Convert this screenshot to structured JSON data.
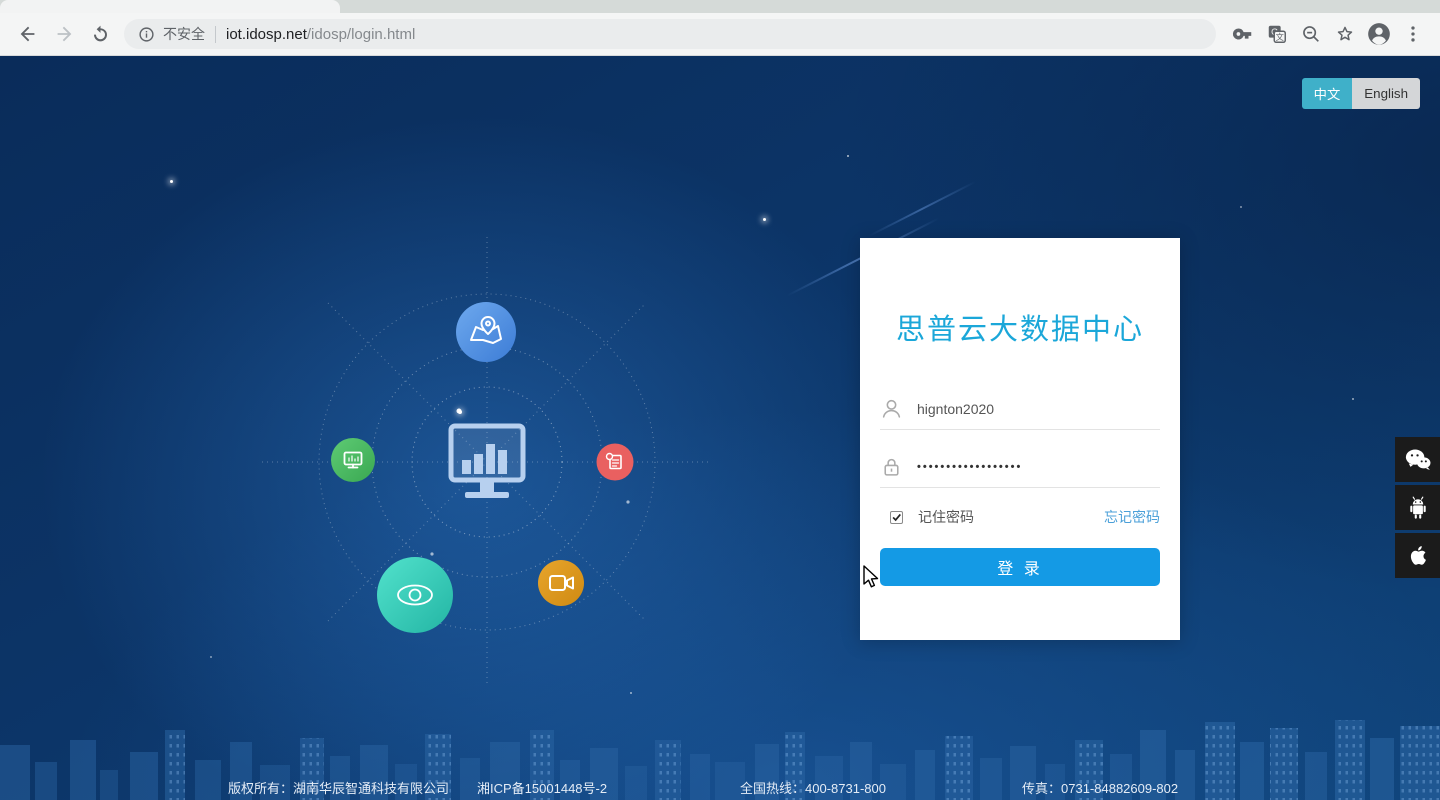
{
  "browser": {
    "security_label": "不安全",
    "url_host": "iot.idosp.net",
    "url_path": "/idosp/login.html"
  },
  "language": {
    "zh": "中文",
    "en": "English"
  },
  "login": {
    "title": "思普云大数据中心",
    "username": "hignton2020",
    "password_masked": "••••••••••••••••••",
    "remember": "记住密码",
    "forgot": "忘记密码",
    "submit": "登 录"
  },
  "footer": {
    "copyright": "版权所有：湖南华辰智通科技有限公司",
    "icp": "湘ICP备15001448号-2",
    "hotline": "全国热线：400-8731-800",
    "fax": "传真：0731-84882609-802"
  },
  "colors": {
    "accent_title": "#1ba7d9",
    "login_button": "#149ae5",
    "toggle_active": "#3fb0c9",
    "link": "#4a9fd8",
    "bg_dark_blue": "#0c3568"
  },
  "icons": {
    "social": [
      "wechat",
      "android",
      "apple"
    ],
    "orbit_center": "monitor-bar-chart",
    "orbit_satellites": [
      "map-pin",
      "screen-monitor",
      "report-document",
      "eye",
      "video-camera"
    ]
  }
}
